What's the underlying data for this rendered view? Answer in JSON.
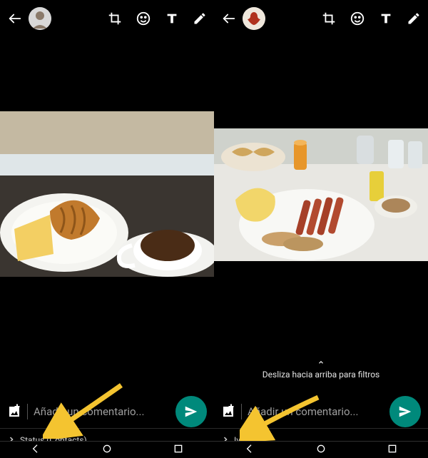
{
  "panes": [
    {
      "caption_placeholder": "Añadir un comentario...",
      "recipient": "Status (Contacts)",
      "filters_hint": null
    },
    {
      "caption_placeholder": "Añadir un comentario...",
      "recipient": "Iván",
      "filters_hint": "Desliza hacia arriba para filtros"
    }
  ],
  "icons": {
    "back": "back-arrow-icon",
    "crop": "crop-rotate-icon",
    "emoji": "emoji-icon",
    "text": "text-tool-icon",
    "draw": "pencil-icon",
    "gallery": "add-photo-icon",
    "send": "send-icon",
    "chevron_right": "chevron-right-icon",
    "chevron_up": "chevron-up-icon",
    "nav_back": "nav-back-icon",
    "nav_home": "nav-home-icon",
    "nav_recent": "nav-recent-icon"
  },
  "colors": {
    "accent": "#00897b",
    "arrow": "#f4c430"
  }
}
